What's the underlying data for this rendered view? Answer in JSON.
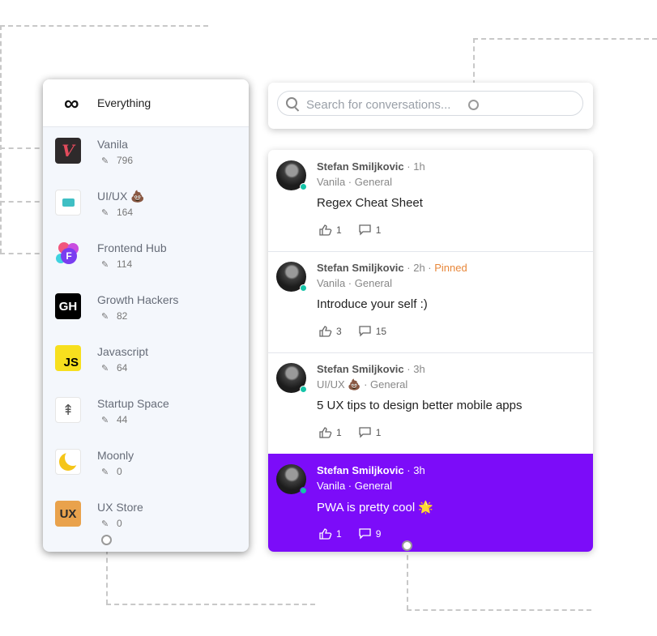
{
  "sidebar": {
    "everything_label": "Everything",
    "communities": [
      {
        "name": "Vanila",
        "count": "796",
        "logo": "vanila-logo"
      },
      {
        "name": "UI/UX 💩",
        "count": "164",
        "logo": "uiux-logo"
      },
      {
        "name": "Frontend Hub",
        "count": "114",
        "logo": "frontend-hub-logo"
      },
      {
        "name": "Growth Hackers",
        "count": "82",
        "logo": "growth-hackers-logo",
        "logo_text": "GH"
      },
      {
        "name": "Javascript",
        "count": "64",
        "logo": "javascript-logo",
        "logo_text": "JS"
      },
      {
        "name": "Startup Space",
        "count": "44",
        "logo": "startup-space-logo"
      },
      {
        "name": "Moonly",
        "count": "0",
        "logo": "moonly-logo"
      },
      {
        "name": "UX Store",
        "count": "0",
        "logo": "ux-store-logo",
        "logo_text": "UX"
      }
    ]
  },
  "search": {
    "placeholder": "Search for conversations..."
  },
  "posts": [
    {
      "author": "Stefan Smiljkovic",
      "time": "1h",
      "pinned": "",
      "community": "Vanila",
      "channel": "General",
      "title": "Regex Cheat Sheet",
      "likes": "1",
      "comments": "1",
      "active": false
    },
    {
      "author": "Stefan Smiljkovic",
      "time": "2h",
      "pinned": "Pinned",
      "community": "Vanila",
      "channel": "General",
      "title": "Introduce your self :)",
      "likes": "3",
      "comments": "15",
      "active": false
    },
    {
      "author": "Stefan Smiljkovic",
      "time": "3h",
      "pinned": "",
      "community": "UI/UX 💩",
      "channel": "General",
      "title": "5 UX tips to design better mobile apps",
      "likes": "1",
      "comments": "1",
      "active": false
    },
    {
      "author": "Stefan Smiljkovic",
      "time": "3h",
      "pinned": "",
      "community": "Vanila",
      "channel": "General",
      "title": "PWA is pretty cool 🌟",
      "likes": "1",
      "comments": "9",
      "active": true
    }
  ],
  "colors": {
    "accent": "#7c0cf9",
    "online": "#15c4a8",
    "pinned": "#e8873a"
  }
}
